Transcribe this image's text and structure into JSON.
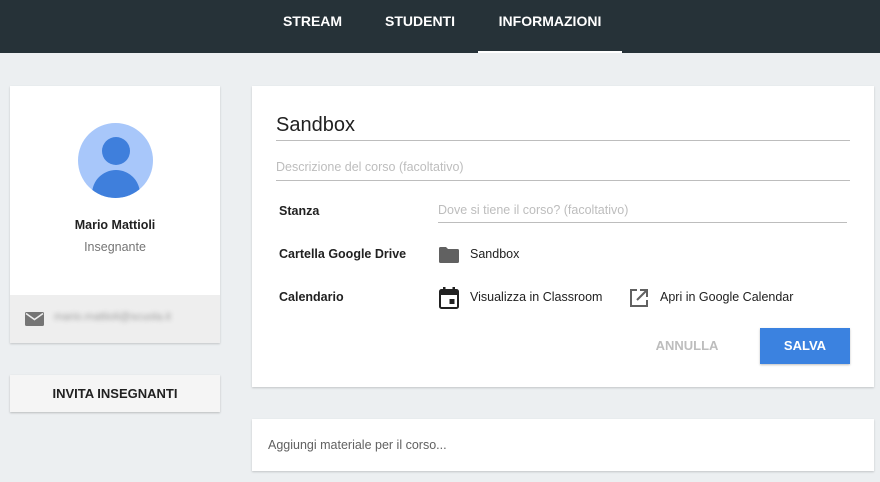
{
  "tabs": [
    {
      "label": "STREAM",
      "active": false
    },
    {
      "label": "STUDENTI",
      "active": false
    },
    {
      "label": "INFORMAZIONI",
      "active": true
    }
  ],
  "profile": {
    "name": "Mario Mattioli",
    "role": "Insegnante",
    "email": "mario.mattioli@scuola.it",
    "avatar_icon": "account-circle-icon",
    "email_icon": "mail-icon"
  },
  "invite_button": "INVITA INSEGNANTI",
  "course": {
    "title": "Sandbox",
    "description_placeholder": "Descrizione del corso (facoltativo)",
    "room_label": "Stanza",
    "room_placeholder": "Dove si tiene il corso? (facoltativo)",
    "drive_label": "Cartella Google Drive",
    "drive_folder": "Sandbox",
    "drive_icon": "folder-icon",
    "calendar_label": "Calendario",
    "view_in_classroom": "Visualizza in Classroom",
    "view_icon": "calendar-icon",
    "open_in_calendar": "Apri in Google Calendar",
    "open_icon": "external-link-icon",
    "cancel": "ANNULLA",
    "save": "SALVA"
  },
  "material_prompt": "Aggiungi materiale per il corso...",
  "colors": {
    "topbar": "#263238",
    "accent": "#3b82e0",
    "avatar_bg": "#a8c7fa",
    "avatar_fg": "#3f7fdc",
    "background": "#eceff1"
  }
}
